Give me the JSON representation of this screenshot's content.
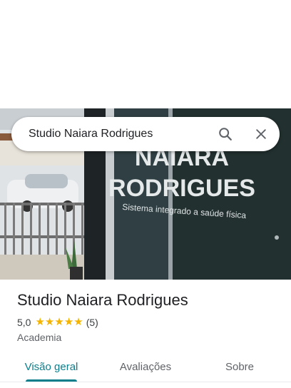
{
  "search": {
    "query": "Studio Naiara Rodrigues"
  },
  "hero": {
    "sign_line1": "NAIARA",
    "sign_line2": "RODRIGUES",
    "sign_tagline": "Sistema integrado a saúde física"
  },
  "place": {
    "name": "Studio Naiara Rodrigues",
    "rating": "5,0",
    "stars": 5,
    "review_count": "(5)",
    "category": "Academia"
  },
  "tabs": [
    {
      "label": "Visão geral",
      "active": true
    },
    {
      "label": "Avaliações",
      "active": false
    },
    {
      "label": "Sobre",
      "active": false
    }
  ],
  "colors": {
    "accent": "#0b7e8b",
    "star": "#f4b400"
  }
}
